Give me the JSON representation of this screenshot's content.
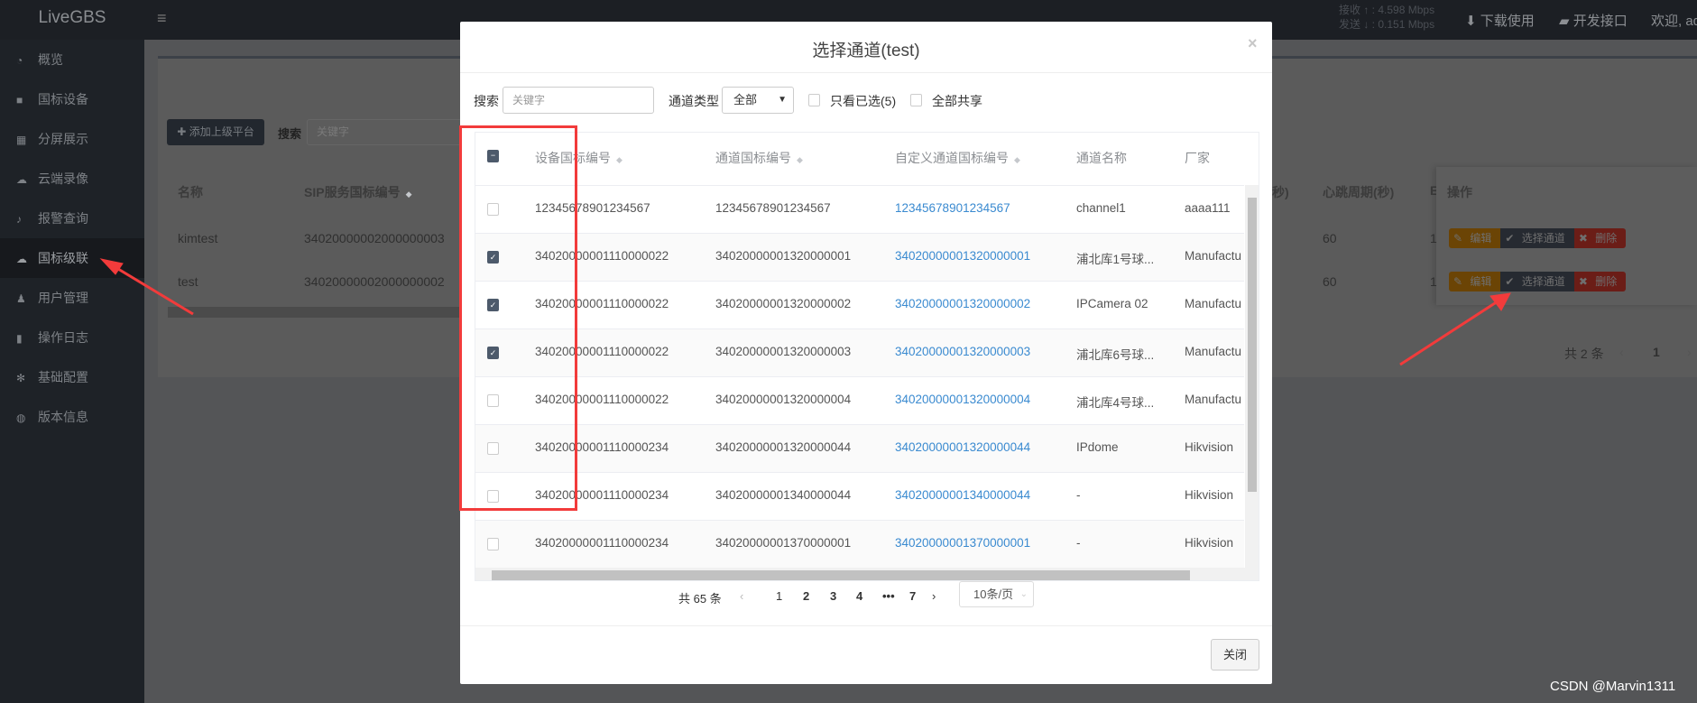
{
  "app": {
    "logo": "LiveGBS"
  },
  "topbar": {
    "rx_label": "接收 ↑ :",
    "rx_value": "4.598 Mbps",
    "tx_label": "发送 ↓ :",
    "tx_value": "0.151 Mbps",
    "download": "下载使用",
    "devapi": "开发接口",
    "welcome": "欢迎, ad"
  },
  "sidebar": {
    "items": [
      {
        "label": "概览",
        "icon": "dashboard-icon"
      },
      {
        "label": "国标设备",
        "icon": "video-camera-icon"
      },
      {
        "label": "分屏展示",
        "icon": "grid-icon"
      },
      {
        "label": "云端录像",
        "icon": "cloud-icon"
      },
      {
        "label": "报警查询",
        "icon": "bell-icon"
      },
      {
        "label": "国标级联",
        "icon": "cloud-upload-icon",
        "active": true
      },
      {
        "label": "用户管理",
        "icon": "users-icon"
      },
      {
        "label": "操作日志",
        "icon": "file-icon"
      },
      {
        "label": "基础配置",
        "icon": "gears-icon"
      },
      {
        "label": "版本信息",
        "icon": "globe-icon"
      }
    ]
  },
  "background": {
    "add_button": "添加上级平台",
    "search_label": "搜索",
    "search_placeholder": "关键字",
    "columns": [
      "名称",
      "SIP服务国标编号",
      "秒)",
      "心跳周期(秒)",
      "E",
      "操作"
    ],
    "rows": [
      {
        "name": "kimtest",
        "sip": "34020000002000000003",
        "heartbeat": "60",
        "e": "1"
      },
      {
        "name": "test",
        "sip": "34020000002000000002",
        "heartbeat": "60",
        "e": "1"
      }
    ],
    "actions": {
      "edit": "编辑",
      "select": "选择通道",
      "delete": "删除"
    },
    "total": "共 2 条",
    "page": "1"
  },
  "modal": {
    "title": "选择通道(test)",
    "close_x": "×",
    "search_label": "搜索",
    "search_placeholder": "关键字",
    "type_label": "通道类型",
    "type_value": "全部",
    "only_selected": "只看已选(5)",
    "share_all": "全部共享",
    "columns": [
      "设备国标编号",
      "通道国标编号",
      "自定义通道国标编号",
      "通道名称",
      "厂家"
    ],
    "rows": [
      {
        "checked": false,
        "device": "12345678901234567",
        "channel": "12345678901234567",
        "custom": "12345678901234567",
        "name": "channel1",
        "vendor": "aaaa111"
      },
      {
        "checked": true,
        "device": "34020000001110000022",
        "channel": "34020000001320000001",
        "custom": "34020000001320000001",
        "name": "浦北库1号球...",
        "vendor": "Manufactu"
      },
      {
        "checked": true,
        "device": "34020000001110000022",
        "channel": "34020000001320000002",
        "custom": "34020000001320000002",
        "name": "IPCamera 02",
        "vendor": "Manufactu"
      },
      {
        "checked": true,
        "device": "34020000001110000022",
        "channel": "34020000001320000003",
        "custom": "34020000001320000003",
        "name": "浦北库6号球...",
        "vendor": "Manufactu"
      },
      {
        "checked": false,
        "device": "34020000001110000022",
        "channel": "34020000001320000004",
        "custom": "34020000001320000004",
        "name": "浦北库4号球...",
        "vendor": "Manufactu"
      },
      {
        "checked": false,
        "device": "34020000001110000234",
        "channel": "34020000001320000044",
        "custom": "34020000001320000044",
        "name": "IPdome",
        "vendor": "Hikvision"
      },
      {
        "checked": false,
        "device": "34020000001110000234",
        "channel": "34020000001340000044",
        "custom": "34020000001340000044",
        "name": "-",
        "vendor": "Hikvision"
      },
      {
        "checked": false,
        "device": "34020000001110000234",
        "channel": "34020000001370000001",
        "custom": "34020000001370000001",
        "name": "-",
        "vendor": "Hikvision"
      }
    ],
    "pagination": {
      "total": "共 65 条",
      "pages": [
        "1",
        "2",
        "3",
        "4",
        "•••",
        "7"
      ],
      "current": "1",
      "page_size": "10条/页"
    },
    "close_button": "关闭"
  },
  "watermark": "CSDN @Marvin1311",
  "colors": {
    "annotation_red": "#f23b3b",
    "link": "#3a8ad0",
    "checkbox": "#4d5a6b"
  }
}
